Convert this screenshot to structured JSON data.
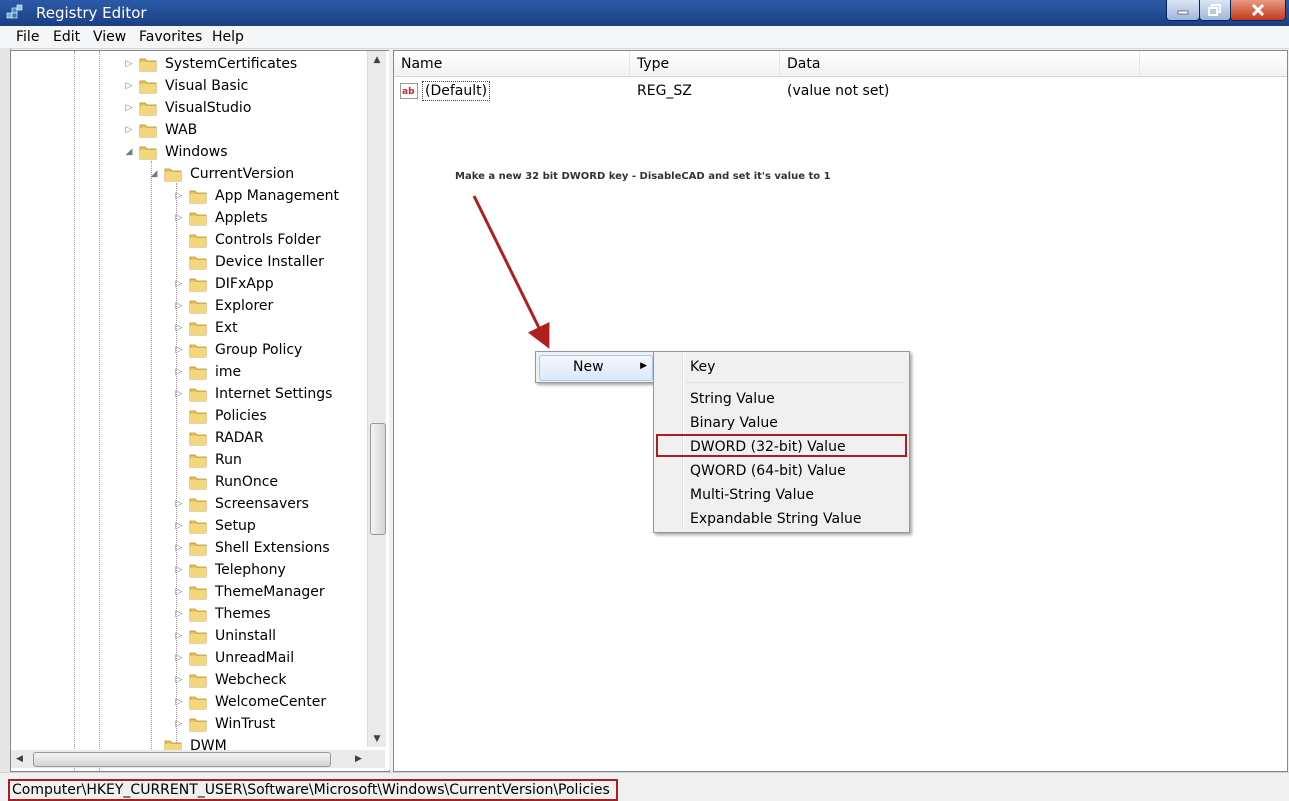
{
  "window": {
    "title": "Registry Editor"
  },
  "menu": [
    "File",
    "Edit",
    "View",
    "Favorites",
    "Help"
  ],
  "tree": {
    "items": [
      {
        "label": "SystemCertificates",
        "level": 0,
        "expander": "collapsed"
      },
      {
        "label": "Visual Basic",
        "level": 0,
        "expander": "collapsed"
      },
      {
        "label": "VisualStudio",
        "level": 0,
        "expander": "collapsed"
      },
      {
        "label": "WAB",
        "level": 0,
        "expander": "collapsed"
      },
      {
        "label": "Windows",
        "level": 0,
        "expander": "expanded"
      },
      {
        "label": "CurrentVersion",
        "level": 1,
        "expander": "expanded"
      },
      {
        "label": "App Management",
        "level": 2,
        "expander": "collapsed"
      },
      {
        "label": "Applets",
        "level": 2,
        "expander": "collapsed"
      },
      {
        "label": "Controls Folder",
        "level": 2,
        "expander": "none"
      },
      {
        "label": "Device Installer",
        "level": 2,
        "expander": "none"
      },
      {
        "label": "DIFxApp",
        "level": 2,
        "expander": "collapsed"
      },
      {
        "label": "Explorer",
        "level": 2,
        "expander": "collapsed"
      },
      {
        "label": "Ext",
        "level": 2,
        "expander": "collapsed"
      },
      {
        "label": "Group Policy",
        "level": 2,
        "expander": "collapsed"
      },
      {
        "label": "ime",
        "level": 2,
        "expander": "collapsed"
      },
      {
        "label": "Internet Settings",
        "level": 2,
        "expander": "collapsed"
      },
      {
        "label": "Policies",
        "level": 2,
        "expander": "none"
      },
      {
        "label": "RADAR",
        "level": 2,
        "expander": "none"
      },
      {
        "label": "Run",
        "level": 2,
        "expander": "none"
      },
      {
        "label": "RunOnce",
        "level": 2,
        "expander": "none"
      },
      {
        "label": "Screensavers",
        "level": 2,
        "expander": "collapsed"
      },
      {
        "label": "Setup",
        "level": 2,
        "expander": "collapsed"
      },
      {
        "label": "Shell Extensions",
        "level": 2,
        "expander": "collapsed"
      },
      {
        "label": "Telephony",
        "level": 2,
        "expander": "collapsed"
      },
      {
        "label": "ThemeManager",
        "level": 2,
        "expander": "collapsed"
      },
      {
        "label": "Themes",
        "level": 2,
        "expander": "collapsed"
      },
      {
        "label": "Uninstall",
        "level": 2,
        "expander": "collapsed"
      },
      {
        "label": "UnreadMail",
        "level": 2,
        "expander": "collapsed"
      },
      {
        "label": "Webcheck",
        "level": 2,
        "expander": "collapsed"
      },
      {
        "label": "WelcomeCenter",
        "level": 2,
        "expander": "collapsed"
      },
      {
        "label": "WinTrust",
        "level": 2,
        "expander": "collapsed"
      },
      {
        "label": "DWM",
        "level": 1,
        "expander": "none"
      }
    ]
  },
  "list": {
    "columns": [
      "Name",
      "Type",
      "Data"
    ],
    "rows": [
      {
        "name": "(Default)",
        "type": "REG_SZ",
        "data": "(value not set)"
      }
    ]
  },
  "annotation": "Make a new 32 bit DWORD key - DisableCAD and set it's value to 1",
  "context_menu": {
    "parent_label": "New",
    "submenu": [
      "Key",
      "String Value",
      "Binary Value",
      "DWORD (32-bit) Value",
      "QWORD (64-bit) Value",
      "Multi-String Value",
      "Expandable String Value"
    ],
    "highlighted": "DWORD (32-bit) Value"
  },
  "status": {
    "path": "Computer\\HKEY_CURRENT_USER\\Software\\Microsoft\\Windows\\CurrentVersion\\Policies"
  },
  "colors": {
    "title_bar": "#1f4a94",
    "highlight": "#a81e22",
    "arrow": "#b01e1e"
  }
}
